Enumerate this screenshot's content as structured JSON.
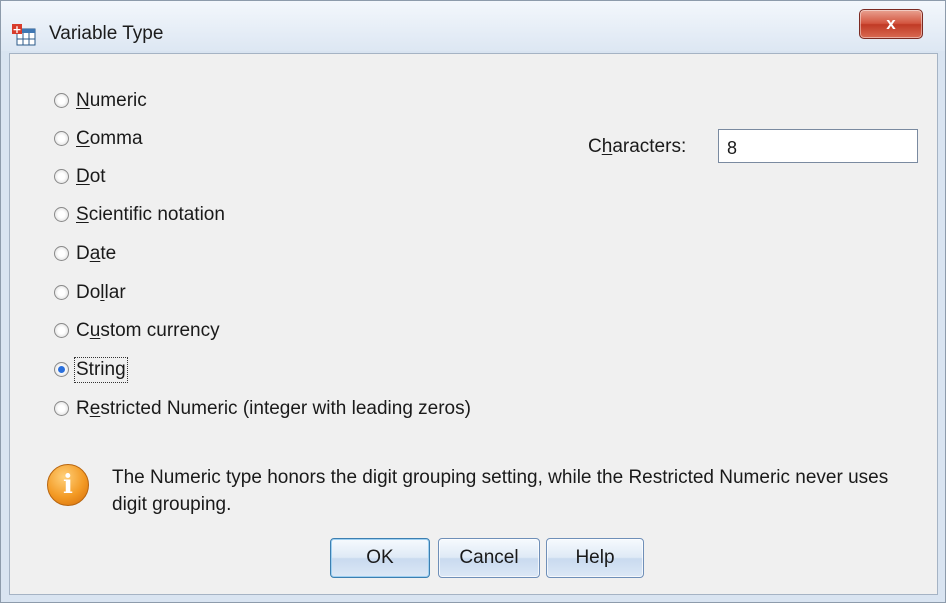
{
  "window": {
    "title": "Variable Type",
    "close_label": "x"
  },
  "radio_options": [
    {
      "pre": "",
      "accel": "N",
      "post": "umeric",
      "checked": false
    },
    {
      "pre": "",
      "accel": "C",
      "post": "omma",
      "checked": false
    },
    {
      "pre": "",
      "accel": "D",
      "post": "ot",
      "checked": false
    },
    {
      "pre": "",
      "accel": "S",
      "post": "cientific notation",
      "checked": false
    },
    {
      "pre": "D",
      "accel": "a",
      "post": "te",
      "checked": false
    },
    {
      "pre": "Do",
      "accel": "l",
      "post": "lar",
      "checked": false
    },
    {
      "pre": "C",
      "accel": "u",
      "post": "stom currency",
      "checked": false
    },
    {
      "pre": "",
      "accel": "",
      "post": "String",
      "checked": true
    },
    {
      "pre": "R",
      "accel": "e",
      "post": "stricted Numeric (integer with leading zeros)",
      "checked": false
    }
  ],
  "characters": {
    "label_pre": "C",
    "label_accel": "h",
    "label_post": "aracters:",
    "value": "8"
  },
  "info": {
    "icon": "info-icon",
    "text": "The Numeric type honors the digit grouping setting, while the Restricted Numeric never uses digit grouping."
  },
  "buttons": {
    "ok": "OK",
    "cancel": "Cancel",
    "help": "Help"
  },
  "colors": {
    "radio_selected": "#2a6fdc",
    "close_button": "#c03a25",
    "info_icon": "#f39a24"
  }
}
